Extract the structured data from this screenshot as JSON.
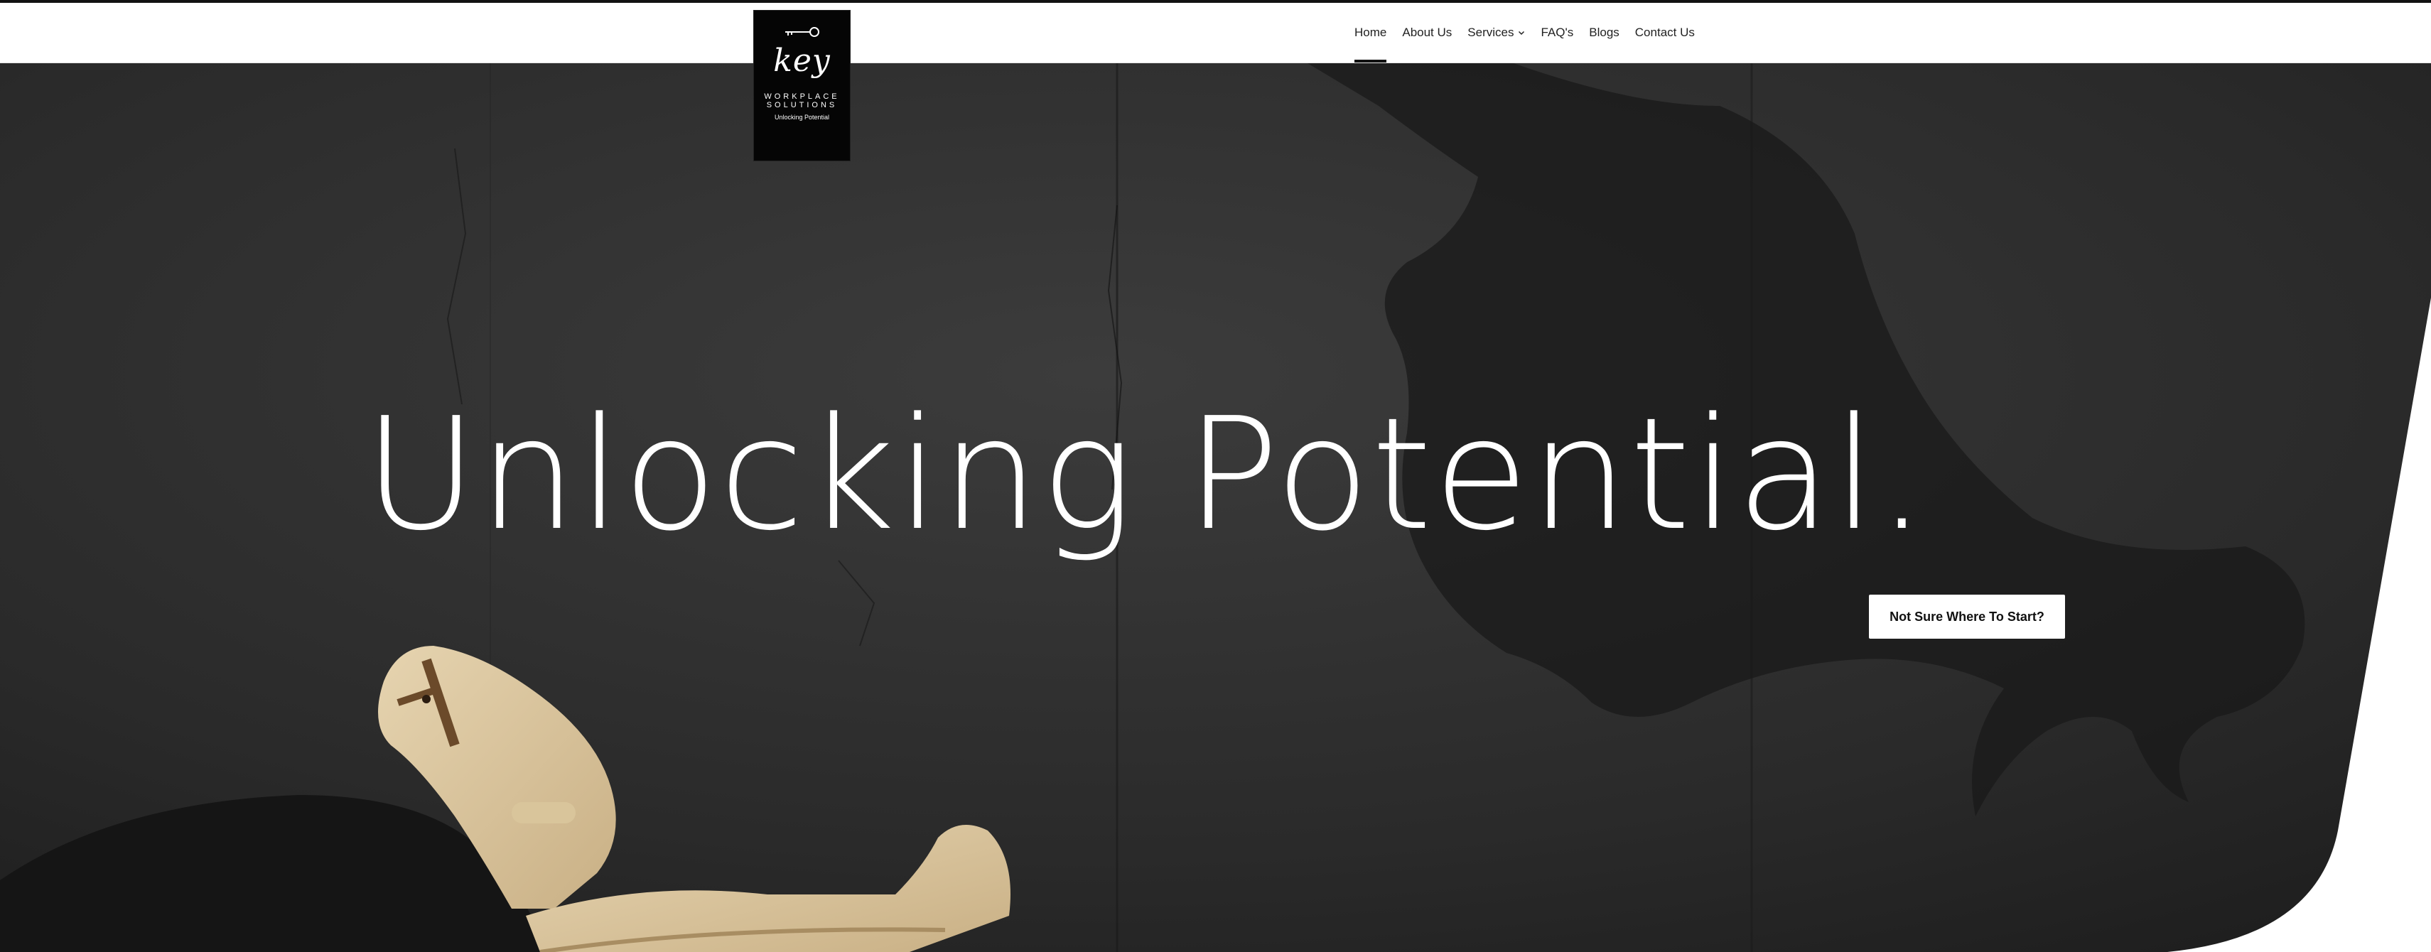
{
  "logo": {
    "icon": "key-icon",
    "word": "key",
    "line1": "WORKPLACE",
    "line2": "SOLUTIONS",
    "tagline": "Unlocking Potential"
  },
  "nav": {
    "items": [
      {
        "label": "Home",
        "active": true
      },
      {
        "label": "About Us"
      },
      {
        "label": "Services",
        "icon": "chevron-down-icon"
      },
      {
        "label": "FAQ's"
      },
      {
        "label": "Blogs"
      },
      {
        "label": "Contact Us"
      }
    ]
  },
  "hero": {
    "title": "Unlocking Potential.",
    "cta_label": "Not Sure Where To Start?"
  },
  "colors": {
    "header_bg": "#ffffff",
    "hero_bg": "#2a2a2a",
    "button_bg": "#ffffff",
    "logo_bg": "#050505"
  }
}
